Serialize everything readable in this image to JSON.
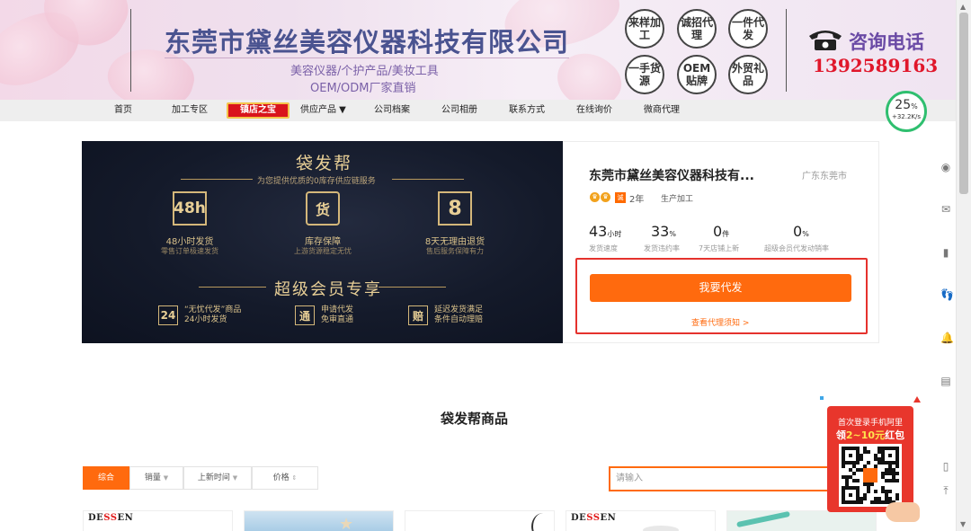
{
  "banner": {
    "company_name": "东莞市黛丝美容仪器科技有限公司",
    "tagline1": "美容仪器/个护产品/美妆工具",
    "tagline2": "OEM/ODM厂家直销",
    "badges": [
      "来样加工",
      "诚招代理",
      "一件代发",
      "一手货源",
      "OEM贴牌",
      "外贸礼品"
    ],
    "consult_label": "咨询电话",
    "phone": "1392589163",
    "phone_icon": "telephone-icon"
  },
  "nav": {
    "items": [
      "首页",
      "加工专区",
      "供应产品 ▼",
      "公司档案",
      "公司相册",
      "联系方式",
      "在线询价",
      "微商代理"
    ],
    "hot_tag": "镇店之宝"
  },
  "speed": {
    "percent": "25",
    "percent_unit": "%",
    "rate": "+32.2K/s"
  },
  "promo": {
    "title": "袋发帮",
    "subtitle": "为您提供优质的0库存供应链服务",
    "features": [
      {
        "icon_text": "48h",
        "title": "48小时发货",
        "desc": "零售订单极速发货"
      },
      {
        "icon_text": "货",
        "title": "库存保障",
        "desc": "上游货源稳定无忧"
      },
      {
        "icon_text": "8",
        "title": "8天无理由退货",
        "desc": "售后服务保障有力"
      }
    ],
    "member_title": "超级会员专享",
    "member_items": [
      {
        "icon_text": "24",
        "line1": "“无忧代发”商品",
        "line2": "24小时发货"
      },
      {
        "icon_text": "通",
        "line1": "申请代发",
        "line2": "免审直通"
      },
      {
        "icon_text": "赔",
        "line1": "延迟发货满足",
        "line2": "条件自动理赔"
      }
    ]
  },
  "shop": {
    "name": "东莞市黛丝美容仪器科技有...",
    "location": "广东东莞市",
    "years": "2年",
    "biz_type": "生产加工",
    "stats": [
      {
        "value": "43",
        "unit": "小时",
        "label": "发货速度"
      },
      {
        "value": "33",
        "unit": "%",
        "label": "发货违约率"
      },
      {
        "value": "0",
        "unit": "件",
        "label": "7天店铺上新"
      },
      {
        "value": "0",
        "unit": "%",
        "label": "超级会员代发动销率"
      }
    ],
    "cta_label": "我要代发",
    "cta_link": "查看代理须知 >"
  },
  "products": {
    "section_title": "袋发帮商品",
    "sort": [
      "综合",
      "销量",
      "上新时间",
      "价格"
    ],
    "search_placeholder": "请输入",
    "brand": [
      "DE",
      "SS",
      "EN"
    ]
  },
  "qr_ad": {
    "line1": "首次登录手机阿里",
    "line2_pre": "领",
    "line2_hi": "2~10元",
    "line2_post": "红包"
  },
  "colors": {
    "accent": "#ff6a0e",
    "red": "#e5322d",
    "gold": "#e8cf96",
    "brand_purple": "#4a5390"
  }
}
